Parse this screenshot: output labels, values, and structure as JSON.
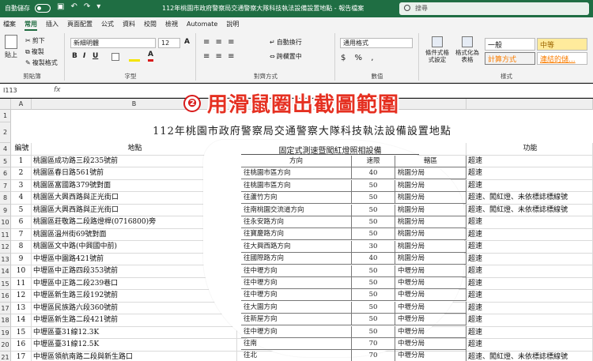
{
  "titlebar": {
    "autosave_label": "自動儲存",
    "doc_title": "112年桃園市政府警察局交通警察大隊科技執法設備設置地點 - 報告檔案",
    "search_placeholder": "搜尋"
  },
  "tabs": [
    "檔案",
    "常用",
    "插入",
    "頁面配置",
    "公式",
    "資料",
    "校閱",
    "檢視",
    "Automate",
    "說明"
  ],
  "active_tab": "常用",
  "ribbon": {
    "clipboard": {
      "paste": "貼上",
      "cut": "剪下",
      "copy": "複製",
      "format_painter": "複製格式",
      "label": "剪貼簿"
    },
    "font": {
      "name": "新細明體",
      "size": "12",
      "bold": "B",
      "italic": "I",
      "underline": "U",
      "label": "字型"
    },
    "alignment": {
      "wrap": "自動換行",
      "merge": "跨欄置中",
      "label": "對齊方式"
    },
    "number": {
      "format": "通用格式",
      "label": "數值"
    },
    "styles": {
      "conditional": "條件式格式設定",
      "format_table": "格式化為表格",
      "normal": "一般",
      "neutral": "中等",
      "calc": "計算方式",
      "linked": "連結的儲...",
      "label": "樣式"
    }
  },
  "formula_bar": {
    "name_box": "I113",
    "fx": "fx"
  },
  "sheet": {
    "columns": [
      "A",
      "B",
      "C",
      "D"
    ],
    "title": "112年桃園市政府警察局交通警察大隊科技執法設備設置地點",
    "headers": {
      "no": "編號",
      "location": "地點",
      "function": "功能"
    },
    "rows": [
      {
        "no": "1",
        "loc": "桃園區成功路三段235號前",
        "func": "超速"
      },
      {
        "no": "2",
        "loc": "桃園區春日路561號前",
        "func": "超速"
      },
      {
        "no": "3",
        "loc": "桃園區富國路379號對面",
        "func": "超速"
      },
      {
        "no": "4",
        "loc": "桃園區大興西路與正光街口",
        "func": "超速、闖紅燈、未依標誌標線號"
      },
      {
        "no": "5",
        "loc": "桃園區大興西路與正光街口",
        "func": "超速、闖紅燈、未依標誌標線號"
      },
      {
        "no": "6",
        "loc": "桃園區莊敬路二段路燈桿(0716800)旁",
        "func": "超速"
      },
      {
        "no": "7",
        "loc": "桃園區溫州街69號對面",
        "func": "超速"
      },
      {
        "no": "8",
        "loc": "桃園區文中路(中興國中前)",
        "func": "超速"
      },
      {
        "no": "9",
        "loc": "中壢區中園路421號前",
        "func": "超速"
      },
      {
        "no": "10",
        "loc": "中壢區中正路四段353號前",
        "func": "超速"
      },
      {
        "no": "11",
        "loc": "中壢區中正路二段239巷口",
        "func": "超速"
      },
      {
        "no": "12",
        "loc": "中壢區新生路三段192號前",
        "func": "超速"
      },
      {
        "no": "13",
        "loc": "中壢區民族路六段360號前",
        "func": "超速"
      },
      {
        "no": "14",
        "loc": "中壢區新生路二段421號前",
        "func": "超速"
      },
      {
        "no": "15",
        "loc": "中壢區臺31線12.3K",
        "func": "超速"
      },
      {
        "no": "16",
        "loc": "中壢區臺31線12.5K",
        "func": "超速"
      },
      {
        "no": "17",
        "loc": "中壢區領航南路二段與新生路口",
        "func": "超速、闖紅燈、未依標誌標線號"
      }
    ]
  },
  "inset": {
    "title": "固定式測速暨闖紅燈照相設備",
    "headers": {
      "direction": "方向",
      "limit": "速限",
      "unit": "轄區"
    },
    "rows": [
      {
        "dir": "往桃園市區方向",
        "limit": "40",
        "unit": "桃園分局"
      },
      {
        "dir": "往桃園市區方向",
        "limit": "50",
        "unit": "桃園分局"
      },
      {
        "dir": "往蘆竹方向",
        "limit": "50",
        "unit": "桃園分局"
      },
      {
        "dir": "往南桃園交流道方向",
        "limit": "50",
        "unit": "桃園分局"
      },
      {
        "dir": "往永安路方向",
        "limit": "50",
        "unit": "桃園分局"
      },
      {
        "dir": "往寶慶路方向",
        "limit": "50",
        "unit": "桃園分局"
      },
      {
        "dir": "往大興西路方向",
        "limit": "30",
        "unit": "桃園分局"
      },
      {
        "dir": "往國際路方向",
        "limit": "40",
        "unit": "桃園分局"
      },
      {
        "dir": "往中壢方向",
        "limit": "50",
        "unit": "中壢分局"
      },
      {
        "dir": "往中壢方向",
        "limit": "50",
        "unit": "中壢分局"
      },
      {
        "dir": "往中壢方向",
        "limit": "50",
        "unit": "中壢分局"
      },
      {
        "dir": "往大園方向",
        "limit": "50",
        "unit": "中壢分局"
      },
      {
        "dir": "往新屋方向",
        "limit": "50",
        "unit": "中壢分局"
      },
      {
        "dir": "往中壢方向",
        "limit": "50",
        "unit": "中壢分局"
      },
      {
        "dir": "往南",
        "limit": "70",
        "unit": "中壢分局"
      },
      {
        "dir": "往北",
        "limit": "70",
        "unit": "中壢分局"
      },
      {
        "dir": "往北",
        "limit": "50",
        "unit": "中壢分局"
      }
    ]
  },
  "annotation": {
    "step": "❷",
    "text": "用滑鼠圈出截圖範圍"
  }
}
